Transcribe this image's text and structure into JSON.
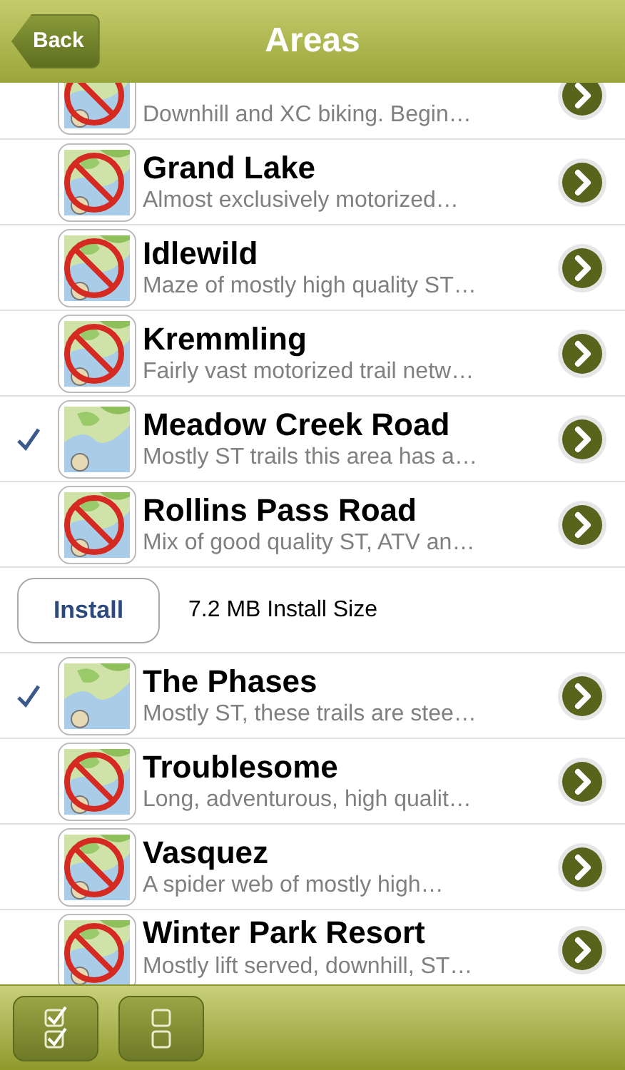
{
  "nav_bar": {
    "back_button": "Back",
    "title": "Areas"
  },
  "areas": [
    {
      "kind": "area",
      "description": "Downhill and XC biking.  Begin…",
      "installed": false
    },
    {
      "kind": "area",
      "title": "Grand Lake",
      "description": "Almost exclusively motorized…",
      "installed": false
    },
    {
      "kind": "area",
      "title": "Idlewild",
      "description": "Maze of mostly high quality ST…",
      "installed": false
    },
    {
      "kind": "area",
      "title": "Kremmling",
      "description": "Fairly vast motorized trail netw…",
      "installed": false
    },
    {
      "kind": "area",
      "title": "Meadow Creek Road",
      "description": "Mostly ST trails this area has a…",
      "installed": true
    },
    {
      "kind": "area",
      "title": "Rollins Pass Road",
      "description": "Mix of good quality ST, ATV an…",
      "installed": false
    },
    {
      "kind": "install",
      "button": "Install",
      "size": "7.2 MB Install Size"
    },
    {
      "kind": "area",
      "title": "The Phases",
      "description": "Mostly ST, these trails are stee…",
      "installed": true
    },
    {
      "kind": "area",
      "title": "Troublesome",
      "description": "Long, adventurous, high qualit…",
      "installed": false
    },
    {
      "kind": "area",
      "title": "Vasquez",
      "description": "A spider web of mostly high…",
      "installed": false
    },
    {
      "kind": "area",
      "title": "Winter Park Resort",
      "description": "Mostly lift served, downhill, ST…",
      "installed": false
    }
  ]
}
